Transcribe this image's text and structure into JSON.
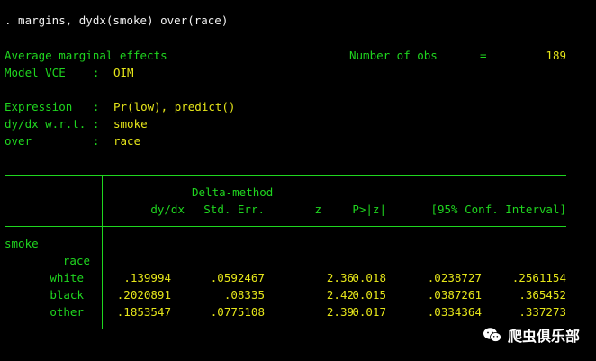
{
  "command": ". margins, dydx(smoke) over(race)",
  "header": {
    "title": "Average marginal effects",
    "nobs_label": "Number of obs",
    "nobs_eq": "=",
    "nobs_value": "189",
    "vce_label": "Model VCE    :",
    "vce_value": "OIM",
    "expr_label": "Expression   :",
    "expr_value": "Pr(low), predict()",
    "dydx_label": "dy/dx w.r.t. :",
    "dydx_value": "smoke",
    "over_label": "over         :",
    "over_value": "race"
  },
  "table": {
    "delta_method": "Delta-method",
    "columns": [
      "dy/dx",
      "Std. Err.",
      "z",
      "P>|z|",
      "[95% Conf. Interval]"
    ],
    "group": "smoke",
    "subgroup": "race",
    "rows": [
      {
        "label": "white",
        "dydx": ".139994",
        "se": ".0592467",
        "z": "2.36",
        "p": "0.018",
        "lo": ".0238727",
        "hi": ".2561154"
      },
      {
        "label": "black",
        "dydx": ".2020891",
        "se": ".08335",
        "z": "2.42",
        "p": "0.015",
        "lo": ".0387261",
        "hi": ".365452"
      },
      {
        "label": "other",
        "dydx": ".1853547",
        "se": ".0775108",
        "z": "2.39",
        "p": "0.017",
        "lo": ".0334364",
        "hi": ".337273"
      }
    ]
  },
  "watermark": {
    "text": "爬虫俱乐部",
    "icon": "wechat-icon"
  },
  "colors": {
    "background": "#000000",
    "command": "#f2f2f2",
    "label": "#1fd61f",
    "value": "#e6e619"
  }
}
